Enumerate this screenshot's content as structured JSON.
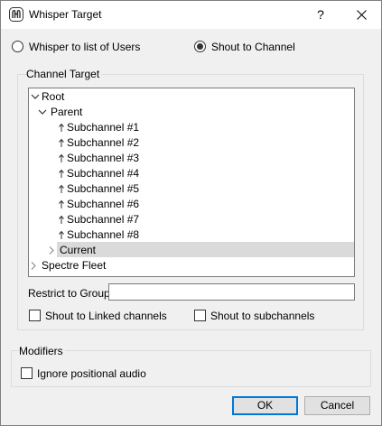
{
  "window": {
    "title": "Whisper Target",
    "help_label": "?",
    "close_icon": "close-icon"
  },
  "mode": {
    "users_label": "Whisper to list of Users",
    "channel_label": "Shout to Channel",
    "selected": "channel"
  },
  "channel_target": {
    "title": "Channel Target",
    "tree": [
      {
        "label": "Root",
        "depth": 0,
        "arrow": "down"
      },
      {
        "label": "Parent",
        "depth": 1,
        "arrow": "down"
      },
      {
        "label": "Subchannel #1",
        "depth": 2,
        "arrow": "up-icon"
      },
      {
        "label": "Subchannel #2",
        "depth": 2,
        "arrow": "up-icon"
      },
      {
        "label": "Subchannel #3",
        "depth": 2,
        "arrow": "up-icon"
      },
      {
        "label": "Subchannel #4",
        "depth": 2,
        "arrow": "up-icon"
      },
      {
        "label": "Subchannel #5",
        "depth": 2,
        "arrow": "up-icon"
      },
      {
        "label": "Subchannel #6",
        "depth": 2,
        "arrow": "up-icon"
      },
      {
        "label": "Subchannel #7",
        "depth": 2,
        "arrow": "up-icon"
      },
      {
        "label": "Subchannel #8",
        "depth": 2,
        "arrow": "up-icon"
      },
      {
        "label": "Current",
        "depth": 2,
        "arrow": "right",
        "selected": true
      },
      {
        "label": "Spectre Fleet",
        "depth": 0,
        "arrow": "right"
      }
    ],
    "restrict_label": "Restrict to Group",
    "restrict_value": "",
    "linked_label": "Shout to Linked channels",
    "linked_checked": false,
    "subchannels_label": "Shout to subchannels",
    "subchannels_checked": false
  },
  "modifiers": {
    "title": "Modifiers",
    "positional_label": "Ignore positional audio",
    "positional_checked": false
  },
  "buttons": {
    "ok": "OK",
    "cancel": "Cancel"
  }
}
